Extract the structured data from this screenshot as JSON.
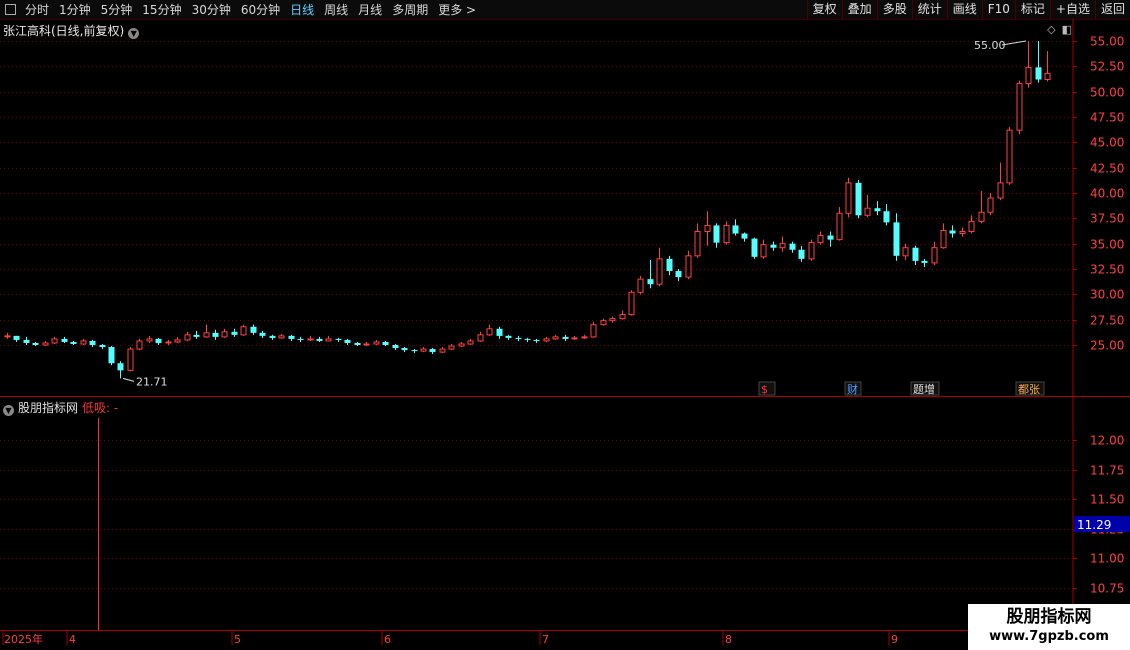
{
  "toolbar": {
    "periods": [
      "分时",
      "1分钟",
      "5分钟",
      "15分钟",
      "30分钟",
      "60分钟",
      "日线",
      "周线",
      "月线",
      "多周期",
      "更多 >"
    ],
    "active_period": "日线",
    "buttons": [
      "复权",
      "叠加",
      "多股",
      "统计",
      "画线",
      "F10",
      "标记",
      "+自选",
      "返回"
    ]
  },
  "main_title": "张江高科(日线,前复权)",
  "indicator": {
    "name": "股朋指标网",
    "label": "低吸: -"
  },
  "price_axis": [
    "55.00",
    "52.50",
    "50.00",
    "47.50",
    "45.00",
    "42.50",
    "40.00",
    "37.50",
    "35.00",
    "32.50",
    "30.00",
    "27.50",
    "25.00"
  ],
  "indicator_axis": [
    "12.00",
    "11.75",
    "11.50",
    "11.25",
    "11.00",
    "10.75"
  ],
  "indicator_value_box": "11.29",
  "high_label": "55.00",
  "low_label": "21.71",
  "event_marks": [
    {
      "text": "$",
      "color": "#ff3030"
    },
    {
      "text": "财",
      "color": "#4aa0ff"
    },
    {
      "text": "题增",
      "color": "#e0e0e0"
    },
    {
      "text": "都张",
      "color": "#ffb040"
    }
  ],
  "date_labels": [
    "2025年",
    "4",
    "5",
    "6",
    "7",
    "8",
    "9"
  ],
  "watermark": {
    "line1": "股朋指标网",
    "line2": "www.7gpzb.com"
  },
  "colors": {
    "up": "#ff4040",
    "down": "#54ffff",
    "grid": "#7a0000",
    "border": "#aa0000",
    "accent": "#5dd3ff"
  },
  "chart_data": {
    "type": "candlestick",
    "price_ylim": [
      21.0,
      56.0
    ],
    "candles": [
      [
        25.9,
        25.9,
        26.2,
        25.6
      ],
      [
        25.9,
        25.5,
        25.9,
        25.3
      ],
      [
        25.5,
        25.2,
        25.8,
        25.0
      ],
      [
        25.2,
        25.0,
        25.3,
        24.9
      ],
      [
        25.0,
        25.2,
        25.4,
        24.9
      ],
      [
        25.2,
        25.6,
        25.8,
        25.1
      ],
      [
        25.6,
        25.3,
        25.8,
        25.2
      ],
      [
        25.3,
        25.1,
        25.4,
        25.0
      ],
      [
        25.1,
        25.4,
        25.6,
        25.0
      ],
      [
        25.4,
        25.0,
        25.5,
        24.8
      ],
      [
        25.0,
        24.8,
        25.1,
        24.6
      ],
      [
        24.8,
        23.2,
        24.9,
        23.0
      ],
      [
        23.2,
        22.5,
        23.4,
        21.71
      ],
      [
        22.5,
        24.6,
        24.8,
        22.4
      ],
      [
        24.6,
        25.4,
        25.6,
        24.5
      ],
      [
        25.4,
        25.6,
        25.9,
        25.2
      ],
      [
        25.6,
        25.2,
        25.7,
        25.0
      ],
      [
        25.2,
        25.3,
        25.5,
        25.0
      ],
      [
        25.3,
        25.5,
        25.8,
        25.2
      ],
      [
        25.5,
        26.0,
        26.3,
        25.4
      ],
      [
        26.0,
        25.8,
        26.4,
        25.6
      ],
      [
        25.8,
        26.2,
        27.0,
        25.7
      ],
      [
        26.2,
        25.8,
        26.5,
        25.5
      ],
      [
        25.8,
        26.3,
        26.6,
        25.7
      ],
      [
        26.3,
        26.0,
        26.6,
        25.8
      ],
      [
        26.0,
        26.8,
        27.0,
        25.9
      ],
      [
        26.8,
        26.2,
        27.0,
        26.0
      ],
      [
        26.2,
        25.9,
        26.4,
        25.7
      ],
      [
        25.9,
        25.7,
        26.0,
        25.5
      ],
      [
        25.7,
        25.9,
        26.1,
        25.6
      ],
      [
        25.9,
        25.6,
        26.0,
        25.4
      ],
      [
        25.6,
        25.5,
        25.8,
        25.3
      ],
      [
        25.5,
        25.6,
        25.9,
        25.4
      ],
      [
        25.6,
        25.4,
        25.8,
        25.3
      ],
      [
        25.4,
        25.6,
        25.9,
        25.4
      ],
      [
        25.6,
        25.5,
        25.7,
        25.3
      ],
      [
        25.5,
        25.2,
        25.6,
        25.0
      ],
      [
        25.2,
        25.0,
        25.3,
        24.9
      ],
      [
        25.0,
        25.1,
        25.3,
        24.9
      ],
      [
        25.1,
        25.3,
        25.5,
        25.0
      ],
      [
        25.3,
        25.0,
        25.4,
        24.9
      ],
      [
        25.0,
        24.7,
        25.1,
        24.5
      ],
      [
        24.7,
        24.5,
        24.8,
        24.3
      ],
      [
        24.5,
        24.4,
        24.6,
        24.2
      ],
      [
        24.4,
        24.6,
        24.8,
        24.3
      ],
      [
        24.6,
        24.3,
        24.7,
        24.1
      ],
      [
        24.3,
        24.6,
        24.8,
        24.2
      ],
      [
        24.6,
        24.9,
        25.1,
        24.5
      ],
      [
        24.9,
        25.1,
        25.3,
        24.8
      ],
      [
        25.1,
        25.4,
        25.6,
        25.0
      ],
      [
        25.4,
        26.0,
        26.3,
        25.3
      ],
      [
        26.0,
        26.6,
        27.0,
        25.9
      ],
      [
        26.6,
        25.9,
        26.8,
        25.6
      ],
      [
        25.9,
        25.7,
        26.0,
        25.5
      ],
      [
        25.7,
        25.6,
        25.9,
        25.4
      ],
      [
        25.6,
        25.5,
        25.7,
        25.3
      ],
      [
        25.5,
        25.4,
        25.6,
        25.2
      ],
      [
        25.4,
        25.6,
        25.8,
        25.3
      ],
      [
        25.6,
        25.8,
        26.0,
        25.5
      ],
      [
        25.8,
        25.6,
        26.0,
        25.4
      ],
      [
        25.6,
        25.7,
        25.9,
        25.5
      ],
      [
        25.7,
        25.8,
        26.0,
        25.6
      ],
      [
        25.8,
        27.0,
        27.3,
        25.7
      ],
      [
        27.0,
        27.4,
        27.6,
        26.9
      ],
      [
        27.4,
        27.6,
        27.8,
        27.2
      ],
      [
        27.6,
        28.0,
        28.4,
        27.5
      ],
      [
        28.0,
        30.2,
        30.4,
        27.9
      ],
      [
        30.2,
        31.5,
        31.8,
        30.0
      ],
      [
        31.5,
        31.0,
        33.4,
        30.6
      ],
      [
        31.0,
        33.5,
        34.6,
        30.8
      ],
      [
        33.5,
        32.3,
        33.8,
        31.9
      ],
      [
        32.3,
        31.7,
        32.5,
        31.3
      ],
      [
        31.7,
        33.8,
        34.3,
        31.5
      ],
      [
        33.8,
        36.2,
        37.0,
        33.6
      ],
      [
        36.2,
        36.8,
        38.2,
        34.8
      ],
      [
        36.8,
        35.1,
        37.0,
        34.6
      ],
      [
        35.1,
        36.8,
        37.2,
        34.9
      ],
      [
        36.8,
        36.0,
        37.4,
        35.8
      ],
      [
        36.0,
        35.5,
        36.1,
        35.2
      ],
      [
        35.5,
        33.7,
        35.6,
        33.5
      ],
      [
        33.7,
        34.9,
        35.4,
        33.5
      ],
      [
        34.9,
        34.6,
        35.2,
        34.3
      ],
      [
        34.6,
        35.0,
        35.7,
        34.2
      ],
      [
        35.0,
        34.4,
        35.2,
        34.1
      ],
      [
        34.4,
        33.5,
        34.8,
        33.2
      ],
      [
        33.5,
        35.1,
        35.4,
        33.3
      ],
      [
        35.1,
        35.8,
        36.2,
        34.9
      ],
      [
        35.8,
        35.4,
        36.2,
        34.7
      ],
      [
        35.4,
        38.0,
        38.6,
        35.3
      ],
      [
        38.0,
        41.0,
        41.5,
        37.6
      ],
      [
        41.0,
        37.8,
        41.3,
        37.5
      ],
      [
        37.8,
        38.5,
        39.8,
        37.6
      ],
      [
        38.5,
        38.2,
        39.2,
        37.8
      ],
      [
        38.2,
        37.1,
        38.9,
        36.8
      ],
      [
        37.1,
        33.8,
        38.0,
        33.3
      ],
      [
        33.8,
        34.6,
        35.0,
        33.4
      ],
      [
        34.6,
        33.3,
        34.8,
        32.9
      ],
      [
        33.3,
        33.1,
        33.5,
        32.7
      ],
      [
        33.1,
        34.6,
        35.2,
        32.9
      ],
      [
        34.6,
        36.3,
        37.0,
        34.5
      ],
      [
        36.3,
        36.0,
        36.8,
        35.6
      ],
      [
        36.0,
        36.2,
        36.6,
        35.7
      ],
      [
        36.2,
        37.2,
        37.8,
        36.0
      ],
      [
        37.2,
        38.1,
        40.2,
        37.0
      ],
      [
        38.1,
        39.5,
        40.0,
        37.8
      ],
      [
        39.5,
        41.0,
        43.0,
        39.3
      ],
      [
        41.0,
        46.2,
        46.5,
        40.8
      ],
      [
        46.2,
        50.8,
        51.1,
        45.8
      ],
      [
        50.8,
        52.4,
        55.0,
        50.4
      ],
      [
        52.4,
        51.2,
        55.0,
        50.9
      ],
      [
        51.2,
        51.8,
        54.0,
        51.0
      ]
    ]
  }
}
